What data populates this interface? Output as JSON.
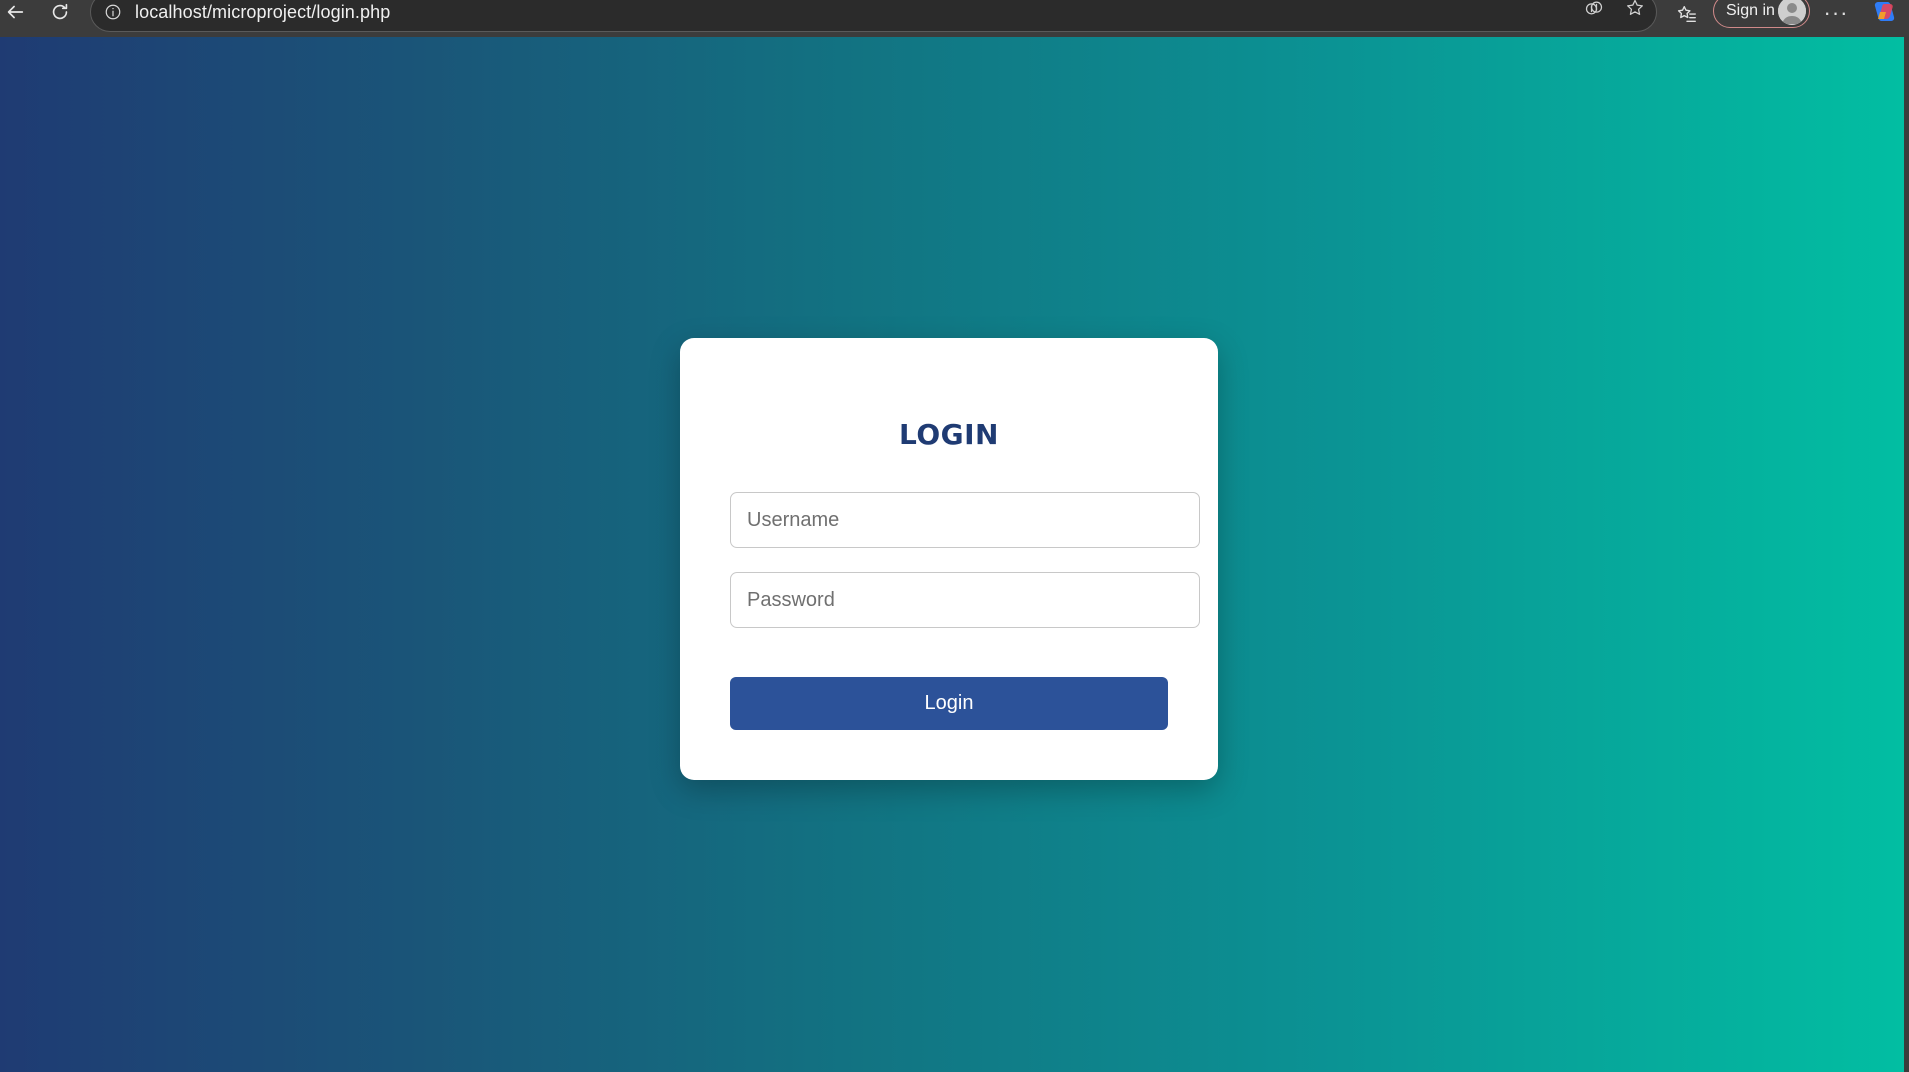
{
  "browser": {
    "url": "localhost/microproject/login.php",
    "signin_label": "Sign in",
    "more_label": "···",
    "icons": {
      "back": "arrow-left-icon",
      "reload": "reload-icon",
      "info": "info-icon",
      "read_aloud": "read-aloud-icon",
      "favorite": "star-icon",
      "favorites_list": "favorites-list-icon",
      "profile": "avatar-icon",
      "copilot": "copilot-icon"
    }
  },
  "login": {
    "title": "LOGIN",
    "username_placeholder": "Username",
    "password_placeholder": "Password",
    "button_label": "Login"
  },
  "colors": {
    "gradient_start": "#1f3b73",
    "gradient_end": "#02bea2",
    "title": "#1f3b73",
    "button": "#2c5299",
    "card": "#ffffff"
  }
}
